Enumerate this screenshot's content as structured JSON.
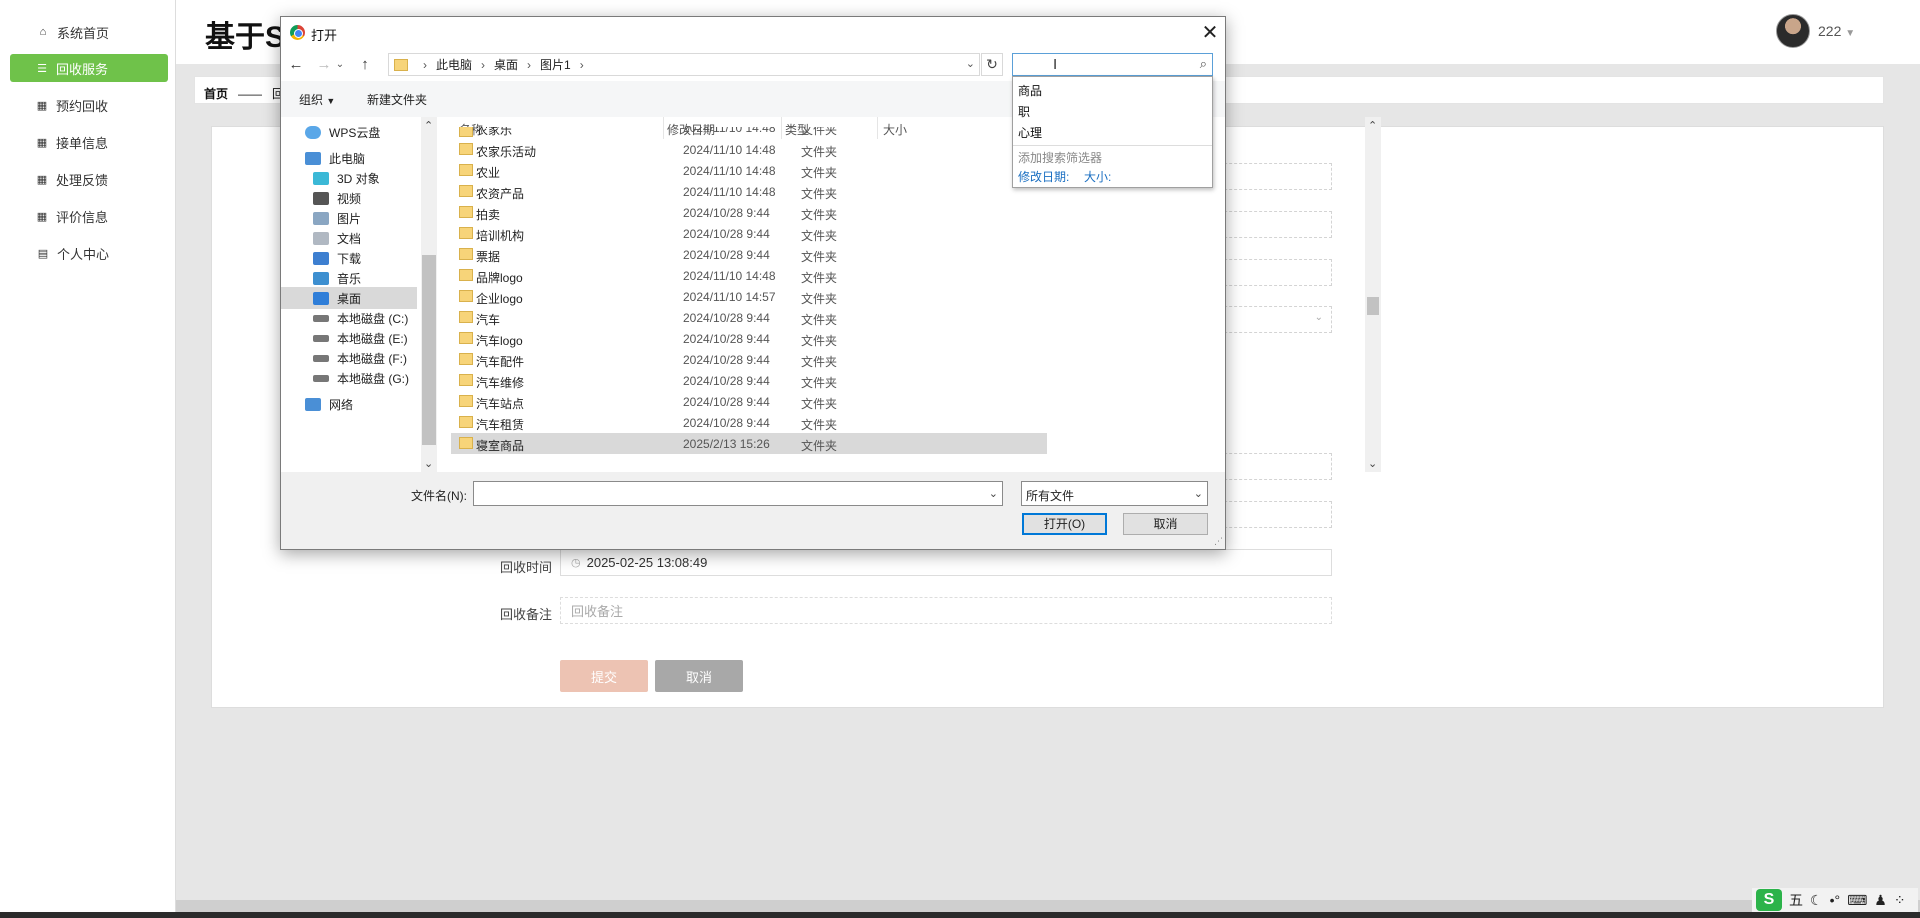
{
  "sidebar": {
    "items": [
      {
        "label": "系统首页",
        "icon": "home-icon",
        "active": false
      },
      {
        "label": "回收服务",
        "icon": "list-icon",
        "active": true
      },
      {
        "label": "预约回收",
        "icon": "grid-icon",
        "active": false
      },
      {
        "label": "接单信息",
        "icon": "grid-icon",
        "active": false
      },
      {
        "label": "处理反馈",
        "icon": "grid-icon",
        "active": false
      },
      {
        "label": "评价信息",
        "icon": "grid-icon",
        "active": false
      },
      {
        "label": "个人中心",
        "icon": "calendar-icon",
        "active": false
      }
    ]
  },
  "header": {
    "title": "基于S",
    "username": "222"
  },
  "breadcrumb": {
    "home": "首页",
    "separator": "——",
    "current": "回"
  },
  "form": {
    "recycle_time_label": "回收时间",
    "recycle_time_value": "2025-02-25 13:08:49",
    "remark_label": "回收备注",
    "remark_placeholder": "回收备注",
    "submit": "提交",
    "cancel": "取消"
  },
  "dialog": {
    "title": "打开",
    "path": [
      "此电脑",
      "桌面",
      "图片1"
    ],
    "toolbar": {
      "organize": "组织",
      "new_folder": "新建文件夹"
    },
    "tree": [
      {
        "label": "WPS云盘",
        "icon": "cloud-icon"
      },
      {
        "label": "此电脑",
        "icon": "computer-icon"
      },
      {
        "label": "3D 对象",
        "icon": "cube-icon"
      },
      {
        "label": "视频",
        "icon": "video-icon"
      },
      {
        "label": "图片",
        "icon": "picture-icon"
      },
      {
        "label": "文档",
        "icon": "document-icon"
      },
      {
        "label": "下载",
        "icon": "download-icon"
      },
      {
        "label": "音乐",
        "icon": "music-icon"
      },
      {
        "label": "桌面",
        "icon": "desktop-icon",
        "selected": true
      },
      {
        "label": "本地磁盘 (C:)",
        "icon": "drive-icon"
      },
      {
        "label": "本地磁盘 (E:)",
        "icon": "drive-icon"
      },
      {
        "label": "本地磁盘 (F:)",
        "icon": "drive-icon"
      },
      {
        "label": "本地磁盘 (G:)",
        "icon": "drive-icon"
      },
      {
        "label": "网络",
        "icon": "network-icon"
      }
    ],
    "columns": {
      "name": "名称",
      "date": "修改日期",
      "type": "类型",
      "size": "大小"
    },
    "files": [
      {
        "name": "农家乐",
        "date": "2024/11/10 14:48",
        "type": "文件夹"
      },
      {
        "name": "农家乐活动",
        "date": "2024/11/10 14:48",
        "type": "文件夹"
      },
      {
        "name": "农业",
        "date": "2024/11/10 14:48",
        "type": "文件夹"
      },
      {
        "name": "农资产品",
        "date": "2024/11/10 14:48",
        "type": "文件夹"
      },
      {
        "name": "拍卖",
        "date": "2024/10/28 9:44",
        "type": "文件夹"
      },
      {
        "name": "培训机构",
        "date": "2024/10/28 9:44",
        "type": "文件夹"
      },
      {
        "name": "票据",
        "date": "2024/10/28 9:44",
        "type": "文件夹"
      },
      {
        "name": "品牌logo",
        "date": "2024/11/10 14:48",
        "type": "文件夹"
      },
      {
        "name": "企业logo",
        "date": "2024/11/10 14:57",
        "type": "文件夹"
      },
      {
        "name": "汽车",
        "date": "2024/10/28 9:44",
        "type": "文件夹"
      },
      {
        "name": "汽车logo",
        "date": "2024/10/28 9:44",
        "type": "文件夹"
      },
      {
        "name": "汽车配件",
        "date": "2024/10/28 9:44",
        "type": "文件夹"
      },
      {
        "name": "汽车维修",
        "date": "2024/10/28 9:44",
        "type": "文件夹"
      },
      {
        "name": "汽车站点",
        "date": "2024/10/28 9:44",
        "type": "文件夹"
      },
      {
        "name": "汽车租赁",
        "date": "2024/10/28 9:44",
        "type": "文件夹"
      },
      {
        "name": "寝室商品",
        "date": "2025/2/13 15:26",
        "type": "文件夹",
        "selected": true
      }
    ],
    "filename_label": "文件名(N):",
    "filename_value": "",
    "filter": "所有文件",
    "open_button": "打开(O)",
    "cancel_button": "取消"
  },
  "search_suggest": {
    "items": [
      "商品",
      "职",
      "心理"
    ],
    "hint": "添加搜索筛选器",
    "filters": [
      "修改日期:",
      "大小:"
    ]
  },
  "ime": {
    "mode": "五"
  }
}
